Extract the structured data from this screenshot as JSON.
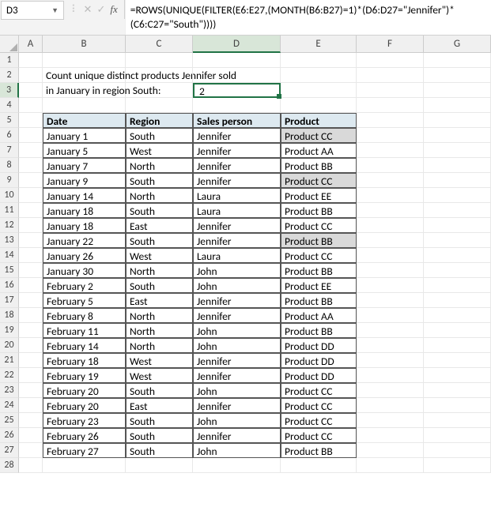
{
  "namebox": {
    "value": "D3"
  },
  "formula": "=ROWS(UNIQUE(FILTER(E6:E27,(MONTH(B6:B27)=1)*(D6:D27=\"Jennifer\")*(C6:C27=\"South\"))))",
  "columns": [
    "A",
    "B",
    "C",
    "D",
    "E",
    "F",
    "G"
  ],
  "active_col_index": 3,
  "row_count": 28,
  "active_row": 3,
  "title_line1": "Count unique distinct products  Jennifer sold",
  "title_line2": "in January in region South:",
  "result": "2",
  "headers": {
    "date": "Date",
    "region": "Region",
    "person": "Sales person",
    "product": "Product"
  },
  "rows": [
    {
      "date": "January 1",
      "region": "South",
      "person": "Jennifer",
      "product": "Product CC",
      "hl": true
    },
    {
      "date": "January 5",
      "region": "West",
      "person": "Jennifer",
      "product": "Product AA"
    },
    {
      "date": "January 7",
      "region": "North",
      "person": "Jennifer",
      "product": "Product BB"
    },
    {
      "date": "January 9",
      "region": "South",
      "person": "Jennifer",
      "product": "Product CC",
      "hl": true
    },
    {
      "date": "January 14",
      "region": "North",
      "person": "Laura",
      "product": "Product EE"
    },
    {
      "date": "January 18",
      "region": "South",
      "person": "Laura",
      "product": "Product BB"
    },
    {
      "date": "January 18",
      "region": "East",
      "person": "Jennifer",
      "product": "Product CC"
    },
    {
      "date": "January 22",
      "region": "South",
      "person": "Jennifer",
      "product": "Product BB",
      "hl": true
    },
    {
      "date": "January 26",
      "region": "West",
      "person": "Laura",
      "product": "Product CC"
    },
    {
      "date": "January 30",
      "region": "North",
      "person": "John",
      "product": "Product BB"
    },
    {
      "date": "February 2",
      "region": "South",
      "person": "John",
      "product": "Product EE"
    },
    {
      "date": "February 5",
      "region": "East",
      "person": "Jennifer",
      "product": "Product BB"
    },
    {
      "date": "February 8",
      "region": "North",
      "person": "Jennifer",
      "product": "Product AA"
    },
    {
      "date": "February 11",
      "region": "North",
      "person": "John",
      "product": "Product BB"
    },
    {
      "date": "February 14",
      "region": "North",
      "person": "John",
      "product": "Product DD"
    },
    {
      "date": "February 18",
      "region": "West",
      "person": "Jennifer",
      "product": "Product DD"
    },
    {
      "date": "February 19",
      "region": "West",
      "person": "Jennifer",
      "product": "Product DD"
    },
    {
      "date": "February 20",
      "region": "South",
      "person": "John",
      "product": "Product CC"
    },
    {
      "date": "February 20",
      "region": "East",
      "person": "Jennifer",
      "product": "Product CC"
    },
    {
      "date": "February 23",
      "region": "South",
      "person": "John",
      "product": "Product CC"
    },
    {
      "date": "February 26",
      "region": "South",
      "person": "Jennifer",
      "product": "Product CC"
    },
    {
      "date": "February 27",
      "region": "South",
      "person": "John",
      "product": "Product BB"
    }
  ]
}
